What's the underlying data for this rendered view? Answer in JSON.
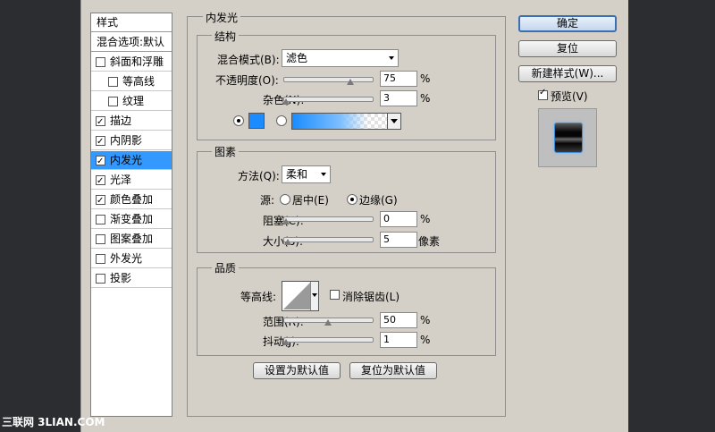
{
  "left_panel": {
    "header_style": "样式",
    "header_blend": "混合选项:默认",
    "items": [
      {
        "label": "斜面和浮雕",
        "checked": false,
        "sub": false
      },
      {
        "label": "等高线",
        "checked": false,
        "sub": true
      },
      {
        "label": "纹理",
        "checked": false,
        "sub": true
      },
      {
        "label": "描边",
        "checked": true,
        "sub": false
      },
      {
        "label": "内阴影",
        "checked": true,
        "sub": false
      },
      {
        "label": "内发光",
        "checked": true,
        "sub": false,
        "selected": true
      },
      {
        "label": "光泽",
        "checked": true,
        "sub": false
      },
      {
        "label": "颜色叠加",
        "checked": true,
        "sub": false
      },
      {
        "label": "渐变叠加",
        "checked": false,
        "sub": false
      },
      {
        "label": "图案叠加",
        "checked": false,
        "sub": false
      },
      {
        "label": "外发光",
        "checked": false,
        "sub": false
      },
      {
        "label": "投影",
        "checked": false,
        "sub": false
      }
    ]
  },
  "main": {
    "title": "内发光",
    "structure": {
      "title": "结构",
      "blend_mode_label": "混合模式(B):",
      "blend_mode_value": "滤色",
      "opacity_label": "不透明度(O):",
      "opacity_value": "75",
      "noise_label": "杂色(N):",
      "noise_value": "3",
      "percent": "%",
      "color_swatch": "#1a8cff"
    },
    "elements": {
      "title": "图素",
      "method_label": "方法(Q):",
      "method_value": "柔和",
      "source_label": "源:",
      "source_center": "居中(E)",
      "source_edge": "边缘(G)",
      "choke_label": "阻塞(C):",
      "choke_value": "0",
      "size_label": "大小(S):",
      "size_value": "5",
      "size_unit": "像素"
    },
    "quality": {
      "title": "品质",
      "contour_label": "等高线:",
      "antialias_label": "消除锯齿(L)",
      "range_label": "范围(R):",
      "range_value": "50",
      "jitter_label": "抖动(J):",
      "jitter_value": "1"
    },
    "make_default": "设置为默认值",
    "reset_default": "复位为默认值"
  },
  "right": {
    "ok": "确定",
    "reset": "复位",
    "new_style": "新建样式(W)...",
    "preview_label": "预览(V)"
  },
  "watermark": "三联网 3LIAN.COM"
}
